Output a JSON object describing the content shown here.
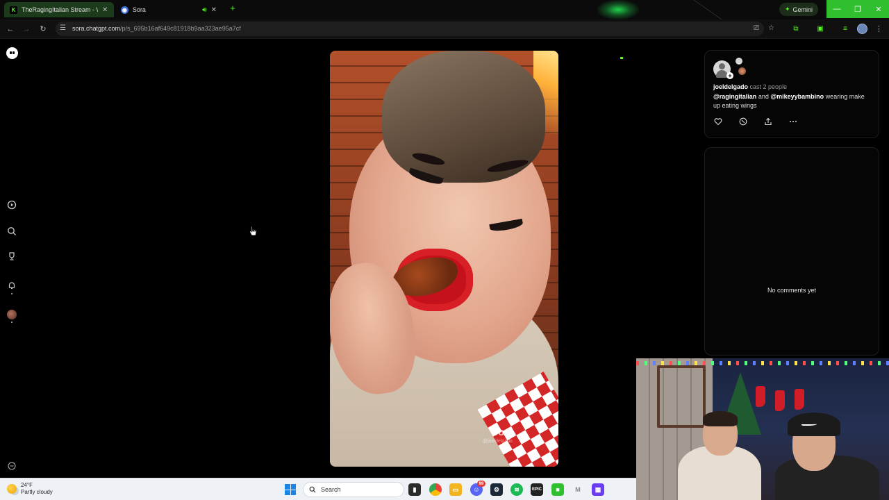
{
  "browser": {
    "tabs": [
      {
        "label": "TheRagingItalian Stream - Watc",
        "favicon": "kick-icon",
        "active": true
      },
      {
        "label": "Sora",
        "favicon": "sora-icon",
        "active": false
      }
    ],
    "gemini_label": "Gemini",
    "url_host": "sora.chatgpt.com",
    "url_path": "/p/s_695b16af649c81918b9aa323ae95a7cf"
  },
  "video": {
    "watermark": "Sora",
    "watermark_handle": "@joeldelgado"
  },
  "post": {
    "author": "joeldelgado",
    "cast_text": "cast 2 people",
    "mention1": "@ragingitalian",
    "and_text": "and",
    "mention2": "@mikeyybambino",
    "caption": "wearing make up eating wings"
  },
  "comments": {
    "empty_text": "No comments yet"
  },
  "taskbar": {
    "temperature": "24°F",
    "condition": "Partly cloudy",
    "search_placeholder": "Search",
    "badge_count": "99"
  },
  "colors": {
    "accent_green": "#53fc18",
    "background": "#000000",
    "lip_red": "#d81f26"
  }
}
